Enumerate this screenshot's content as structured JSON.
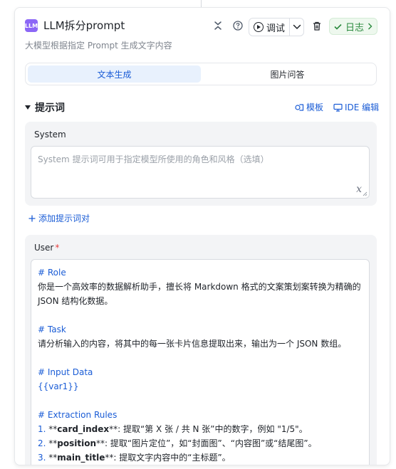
{
  "header": {
    "logo_text": "LLM",
    "title": "LLM拆分prompt",
    "debug_label": "调试",
    "log_label": "日志",
    "subtitle": "大模型根据指定 Prompt 生成文字内容"
  },
  "tabs": [
    "文本生成",
    "图片问答"
  ],
  "prompt_section": {
    "title": "提示词",
    "template_label": "模板",
    "ide_label": "IDE 编辑"
  },
  "system": {
    "label": "System",
    "placeholder": "System 提示词可用于指定模型所使用的角色和风格（选填）",
    "fx": "x"
  },
  "add_pair_label": "添加提示词对",
  "user": {
    "label": "User",
    "required_mark": "*",
    "lines": [
      {
        "t": "# Role",
        "k": "h"
      },
      {
        "t": "你是一个高效率的数据解析助手，擅长将 Markdown 格式的文案策划案转换为精确的",
        "k": "n"
      },
      {
        "t": "JSON 结构化数据。",
        "k": "n"
      },
      {
        "t": "",
        "k": "n"
      },
      {
        "t": "# Task",
        "k": "h"
      },
      {
        "t": "请分析输入的内容，将其中的每一张卡片信息提取出来，输出为一个 JSON 数组。",
        "k": "n"
      },
      {
        "t": "",
        "k": "n"
      },
      {
        "t": "# Input Data",
        "k": "h"
      },
      {
        "t": "{{var1}}",
        "k": "h"
      },
      {
        "t": "",
        "k": "n"
      },
      {
        "t": "# Extraction Rules",
        "k": "h"
      }
    ],
    "rules": [
      {
        "num": "1. ",
        "pre": "**",
        "key": "card_index",
        "post": "**",
        "desc": ": 提取“第 X 张 / 共 N 张”中的数字，例如 \"1/5\"。"
      },
      {
        "num": "2. ",
        "pre": "**",
        "key": "position",
        "post": "**",
        "desc": ": 提取“图片定位”，如“封面图”、“内容图”或“结尾图”。"
      },
      {
        "num": "3. ",
        "pre": "**",
        "key": "main_title",
        "post": "**",
        "desc": ": 提取文字内容中的“主标题”。"
      }
    ]
  },
  "colors": {
    "accent": "#1a5cd6",
    "log_green": "#2b8a3e",
    "logo_purple": "#8c67f6",
    "required_red": "#e53e3e"
  }
}
